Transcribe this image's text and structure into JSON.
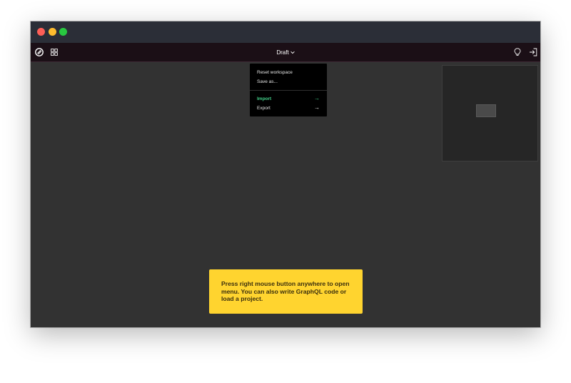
{
  "toolbar": {
    "draft_label": "Draft",
    "left_icons": [
      "logo-icon",
      "grid-icon"
    ],
    "right_icons": [
      "lightbulb-icon",
      "sign-in-icon"
    ]
  },
  "menu": {
    "items": [
      {
        "label": "Reset workspace",
        "has_submenu": false,
        "active": false
      },
      {
        "label": "Save as...",
        "has_submenu": false,
        "active": false
      },
      {
        "label": "Import",
        "has_submenu": true,
        "active": true
      },
      {
        "label": "Export",
        "has_submenu": true,
        "active": false
      }
    ],
    "submenu_arrow": "→"
  },
  "hint": {
    "text": "Press right mouse button anywhere to open menu. You can also write GraphQL code or load a project."
  },
  "colors": {
    "accent_green": "#43d18a",
    "hint_yellow": "#ffd42f",
    "canvas": "#323232",
    "toolbar": "#1b0f16"
  }
}
